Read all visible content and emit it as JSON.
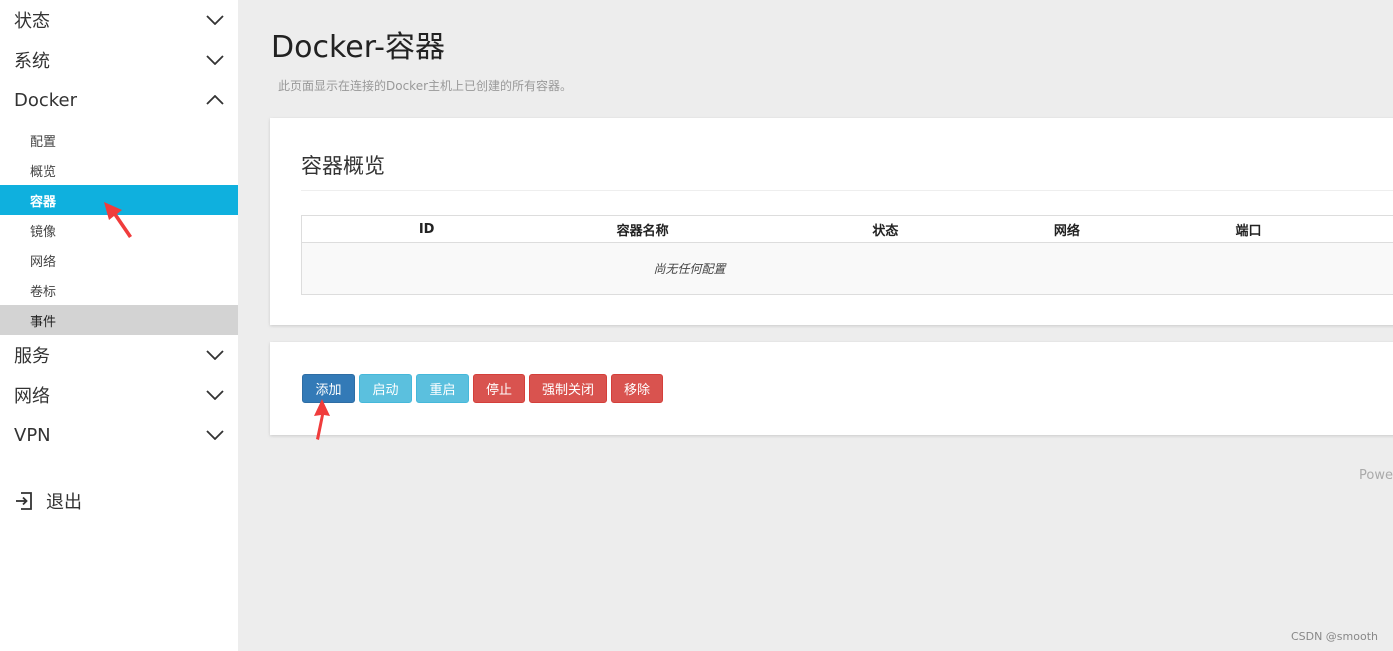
{
  "sidebar": {
    "sections": [
      {
        "label": "状态",
        "chevron": "chevron-down-icon"
      },
      {
        "label": "系统",
        "chevron": "chevron-down-icon"
      },
      {
        "label": "Docker",
        "chevron": "chevron-up-icon"
      }
    ],
    "docker_items": [
      {
        "label": "配置"
      },
      {
        "label": "概览"
      },
      {
        "label": "容器"
      },
      {
        "label": "镜像"
      },
      {
        "label": "网络"
      },
      {
        "label": "卷标"
      },
      {
        "label": "事件"
      }
    ],
    "sections_after": [
      {
        "label": "服务",
        "chevron": "chevron-down-icon"
      },
      {
        "label": "网络",
        "chevron": "chevron-down-icon"
      },
      {
        "label": "VPN",
        "chevron": "chevron-down-icon"
      }
    ],
    "logout_label": "退出",
    "active_color": "#0fb0de"
  },
  "main": {
    "title": "Docker-容器",
    "description": "此页面显示在连接的Docker主机上已创建的所有容器。",
    "overview": {
      "title": "容器概览",
      "columns": [
        "ID",
        "容器名称",
        "状态",
        "网络",
        "端口"
      ],
      "empty_text": "尚无任何配置"
    },
    "actions": {
      "add": "添加",
      "start": "启动",
      "restart": "重启",
      "stop": "停止",
      "force_close": "强制关闭",
      "remove": "移除"
    },
    "footer_partial": "Powe"
  },
  "watermark": "CSDN @smooth",
  "annotation_color": "#f03c3c"
}
